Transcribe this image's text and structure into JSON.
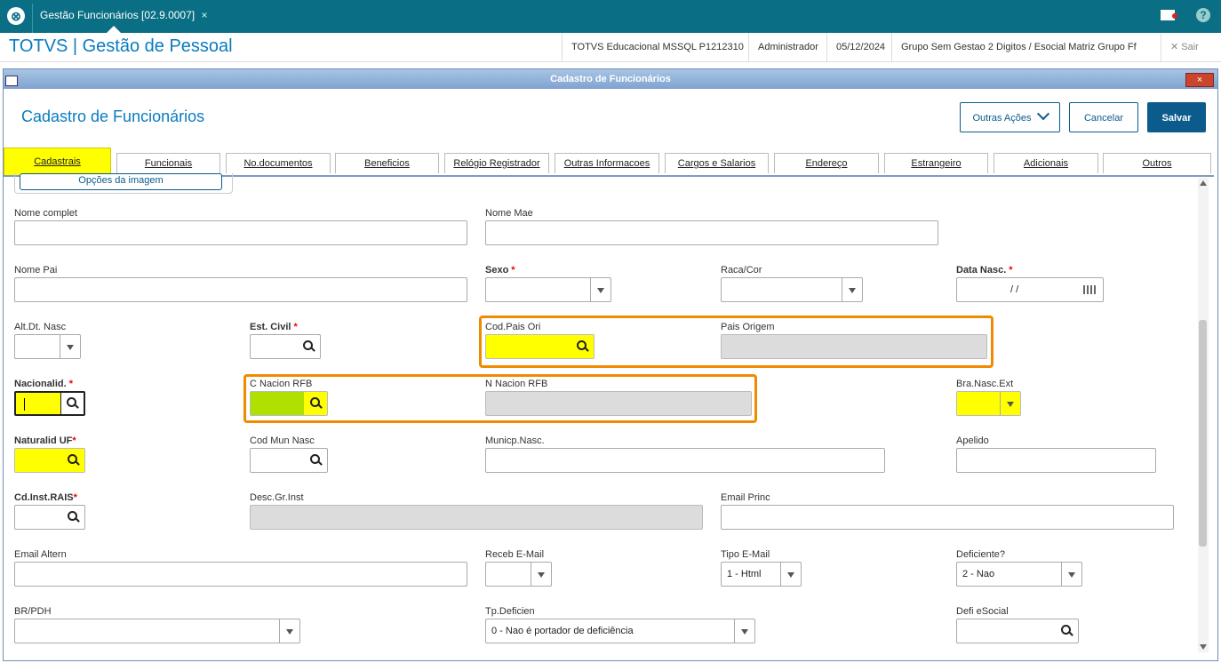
{
  "app": {
    "tab_title": "Gestão Funcionários [02.9.0007]",
    "tab_close": "×",
    "brand": "TOTVS | Gestão de Pessoal",
    "info": [
      "TOTVS Educacional MSSQL P1212310",
      "Administrador",
      "05/12/2024",
      "Grupo Sem Gestao 2 Digitos / Esocial Matriz Grupo Ff"
    ],
    "exit_label": "Sair",
    "help": "?"
  },
  "window": {
    "title": "Cadastro de Funcionários",
    "close": "×"
  },
  "page": {
    "title": "Cadastro de Funcionários",
    "more_actions": "Outras Ações",
    "cancel": "Cancelar",
    "save": "Salvar",
    "image_options": "Opções da imagem"
  },
  "tabs": [
    "Cadastrais",
    "Funcionais",
    "No.documentos",
    "Beneficios",
    "Relógio Registrador",
    "Outras Informacoes",
    "Cargos e Salarios",
    "Endereço",
    "Estrangeiro",
    "Adicionais",
    "Outros"
  ],
  "fields": {
    "nome_complet": "Nome complet",
    "nome_mae": "Nome Mae",
    "nome_pai": "Nome Pai",
    "sexo": "Sexo",
    "raca_cor": "Raca/Cor",
    "data_nasc": "Data Nasc.",
    "data_nasc_value": "/ /",
    "alt_dt_nasc": "Alt.Dt. Nasc",
    "est_civil": "Est. Civil",
    "cod_pais_ori": "Cod.Pais Ori",
    "pais_origem": "Pais Origem",
    "nacionalid": "Nacionalid.",
    "c_nacion_rfb": "C Nacion RFB",
    "n_nacion_rfb": "N Nacion RFB",
    "bra_nasc_ext": "Bra.Nasc.Ext",
    "naturalid_uf": "Naturalid UF",
    "cod_mun_nasc": "Cod Mun Nasc",
    "municp_nasc": "Municp.Nasc.",
    "apelido": "Apelido",
    "cd_inst_rais": "Cd.Inst.RAIS",
    "desc_gr_inst": "Desc.Gr.Inst",
    "email_princ": "Email Princ",
    "email_altern": "Email Altern",
    "receb_email": "Receb E-Mail",
    "tipo_email": "Tipo E-Mail",
    "tipo_email_value": "1 - Html",
    "deficiente": "Deficiente?",
    "deficiente_value": "2 - Nao",
    "br_pdh": "BR/PDH",
    "tp_deficien": "Tp.Deficien",
    "tp_deficien_value": "0 - Nao é portador de deficiência",
    "defi_esocial": "Defi eSocial",
    "required_mark": "*"
  }
}
